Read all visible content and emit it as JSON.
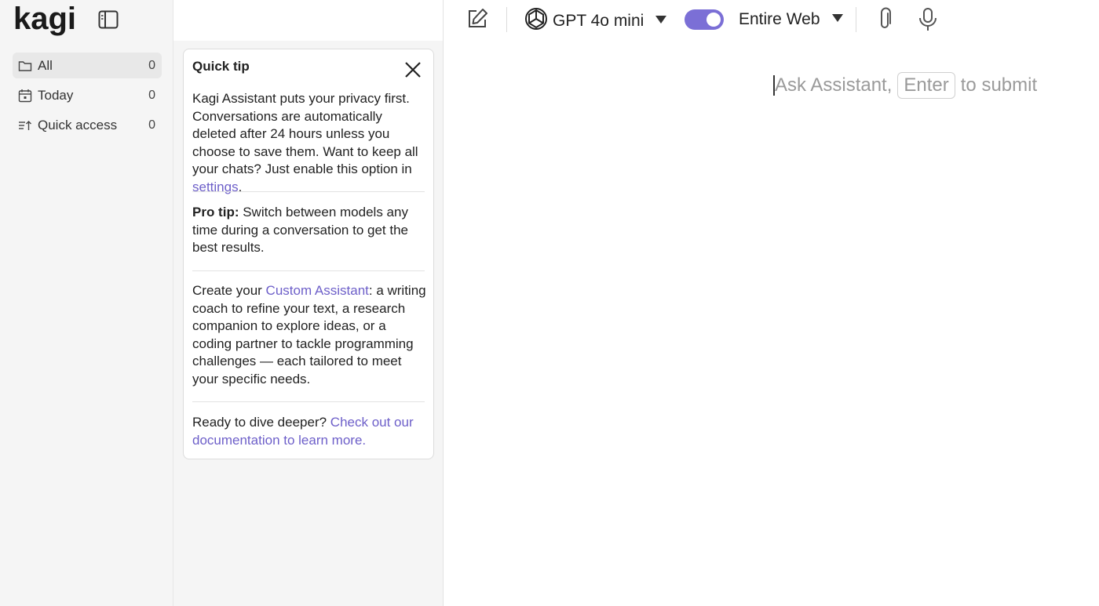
{
  "brand": {
    "logo_text": "kagi"
  },
  "sidebar": {
    "items": [
      {
        "icon": "folder-icon",
        "label": "All",
        "count": "0"
      },
      {
        "icon": "calendar-icon",
        "label": "Today",
        "count": "0"
      },
      {
        "icon": "quick-access-icon",
        "label": "Quick access",
        "count": "0"
      }
    ]
  },
  "tip": {
    "title": "Quick tip",
    "privacy_text": "Kagi Assistant puts your privacy first. Conversations are automatically deleted after 24 hours unless you choose to save them. Want to keep all your chats? Just enable this option in ",
    "privacy_link": "settings",
    "privacy_end": ".",
    "pro_label": "Pro tip:",
    "pro_text": " Switch between models any time during a conversation to get the best results.",
    "custom_pre": "Create your ",
    "custom_link": "Custom Assistant",
    "custom_text": ": a writing coach to refine your text, a research companion to explore ideas, or a coding partner to tackle programming challenges — each tailored to meet your specific needs.",
    "docs_pre": "Ready to dive deeper? ",
    "docs_link": "Check out our documentation to learn more."
  },
  "toolbar": {
    "model_label": "GPT 4o mini",
    "search_scope_label": "Entire Web"
  },
  "prompt": {
    "placeholder_a": "Ask Assistant,",
    "placeholder_key": "Enter",
    "placeholder_b": "to submit"
  },
  "colors": {
    "accent": "#7b6fd6",
    "link": "#6d5fc9"
  }
}
